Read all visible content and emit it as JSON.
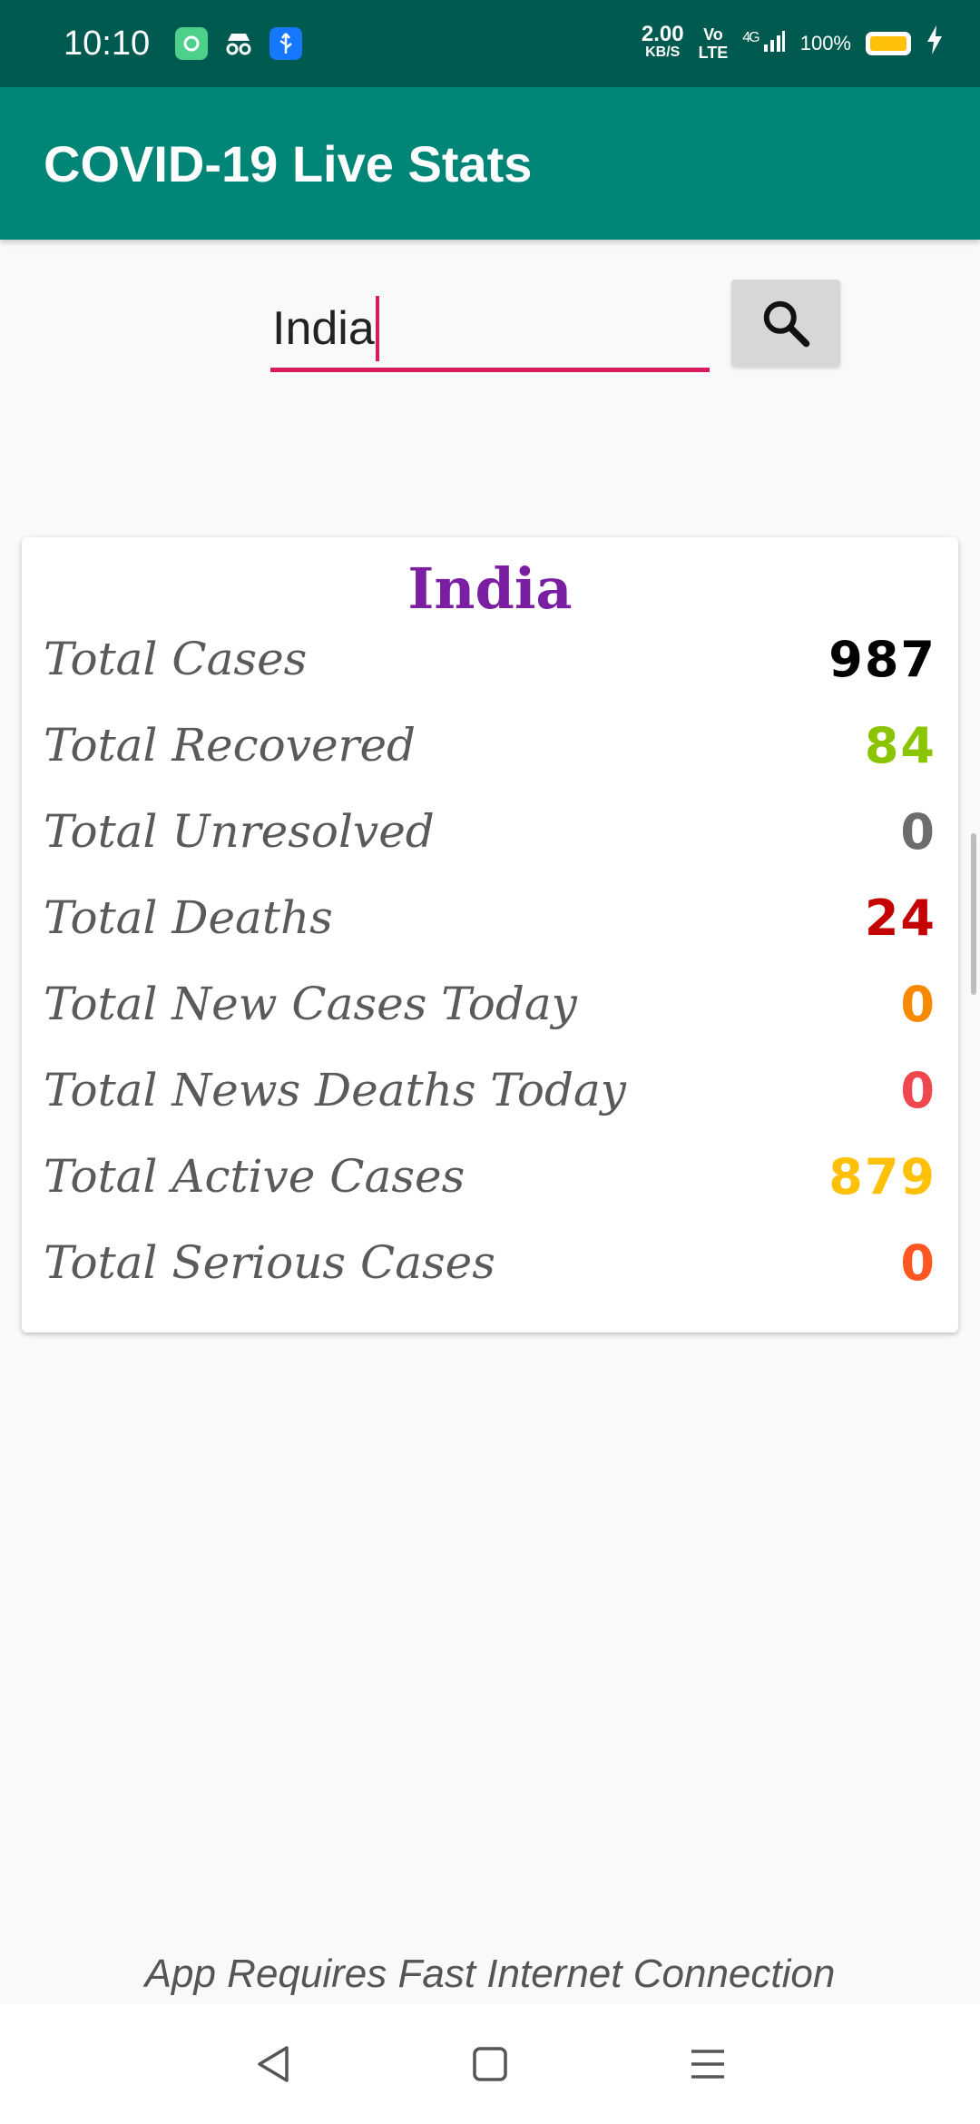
{
  "status_bar": {
    "time": "10:10",
    "net_speed_value": "2.00",
    "net_speed_unit": "KB/S",
    "volte_top": "Vo",
    "volte_bottom": "LTE",
    "network": "4G",
    "battery_percent": "100%",
    "icons": [
      "app-icon",
      "incognito-icon",
      "usb-icon",
      "signal-icon",
      "battery-icon",
      "charging-icon"
    ],
    "battery_color": "#ffc107"
  },
  "app_bar": {
    "title": "COVID-19 Live Stats",
    "color": "#008577"
  },
  "search": {
    "value": "India",
    "button_icon": "search-icon",
    "underline_color": "#d81b60"
  },
  "card": {
    "country": "India",
    "country_color": "#7b1fa2",
    "stats": [
      {
        "label": "Total Cases",
        "value": "987",
        "color": "#000000"
      },
      {
        "label": "Total Recovered",
        "value": "84",
        "color": "#8bc400"
      },
      {
        "label": "Total Unresolved",
        "value": "0",
        "color": "#6d6d6d"
      },
      {
        "label": "Total Deaths",
        "value": "24",
        "color": "#c40000"
      },
      {
        "label": "Total New Cases Today",
        "value": "0",
        "color": "#f78a00"
      },
      {
        "label": "Total News Deaths Today",
        "value": "0",
        "color": "#f0464e"
      },
      {
        "label": "Total Active Cases",
        "value": "879",
        "color": "#ffc107"
      },
      {
        "label": "Total Serious Cases",
        "value": "0",
        "color": "#ff5722"
      }
    ]
  },
  "footer": {
    "note": "App Requires Fast Internet Connection"
  },
  "nav_bar": {
    "icons": [
      "back-icon",
      "home-icon",
      "menu-icon"
    ]
  }
}
